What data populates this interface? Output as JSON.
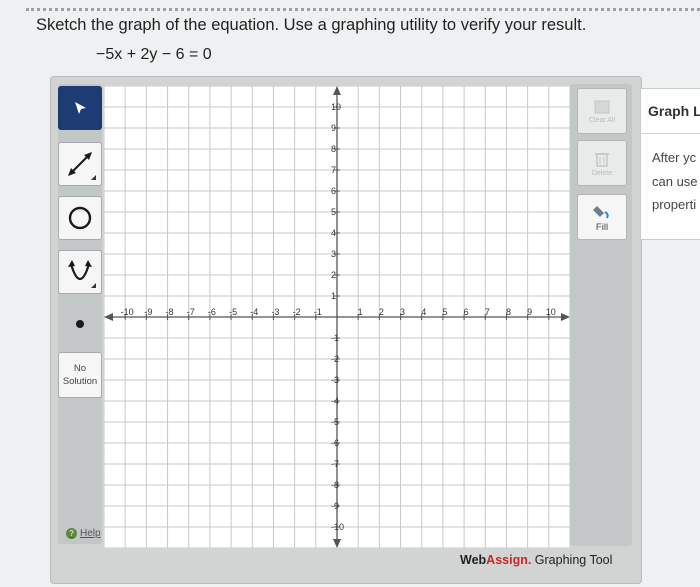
{
  "question": {
    "instruction": "Sketch the graph of the equation. Use a graphing utility to verify your result.",
    "equation": "−5x + 2y − 6 = 0"
  },
  "left_toolbar": {
    "tools": [
      {
        "name": "pointer",
        "icon": "cursor-arrow-icon",
        "active": true
      },
      {
        "name": "line",
        "icon": "line-tool-icon"
      },
      {
        "name": "circle",
        "icon": "circle-tool-icon"
      },
      {
        "name": "parabola",
        "icon": "parabola-tool-icon"
      },
      {
        "name": "point",
        "icon": "point-tool-icon"
      }
    ],
    "no_solution_line1": "No",
    "no_solution_line2": "Solution",
    "help_label": "Help"
  },
  "right_toolbar": {
    "clear_all_label": "Clear All",
    "delete_label": "Delete",
    "fill_label": "Fill"
  },
  "graph": {
    "x_min": -11,
    "x_max": 11,
    "y_min": -11,
    "y_max": 11,
    "x_tick_labels": [
      "-10",
      "-9",
      "-8",
      "-7",
      "-6",
      "-5",
      "-4",
      "-3",
      "-2",
      "-1",
      "1",
      "2",
      "3",
      "4",
      "5",
      "6",
      "7",
      "8",
      "9",
      "10"
    ],
    "y_tick_labels": [
      "10",
      "9",
      "8",
      "7",
      "6",
      "5",
      "4",
      "3",
      "2",
      "1",
      "-1",
      "-2",
      "-3",
      "-4",
      "-5",
      "-6",
      "-7",
      "-8",
      "-9",
      "-10"
    ]
  },
  "branding": {
    "web": "Web",
    "assign": "Assign.",
    "suffix": " Graphing Tool"
  },
  "side_panel": {
    "title": "Graph L",
    "line1": "After yc",
    "line2": "can use",
    "line3": "properti"
  },
  "colors": {
    "active_tool": "#1f3b73",
    "brand_red": "#c62828",
    "grid": "#c8c8c8",
    "axis": "#555555"
  }
}
